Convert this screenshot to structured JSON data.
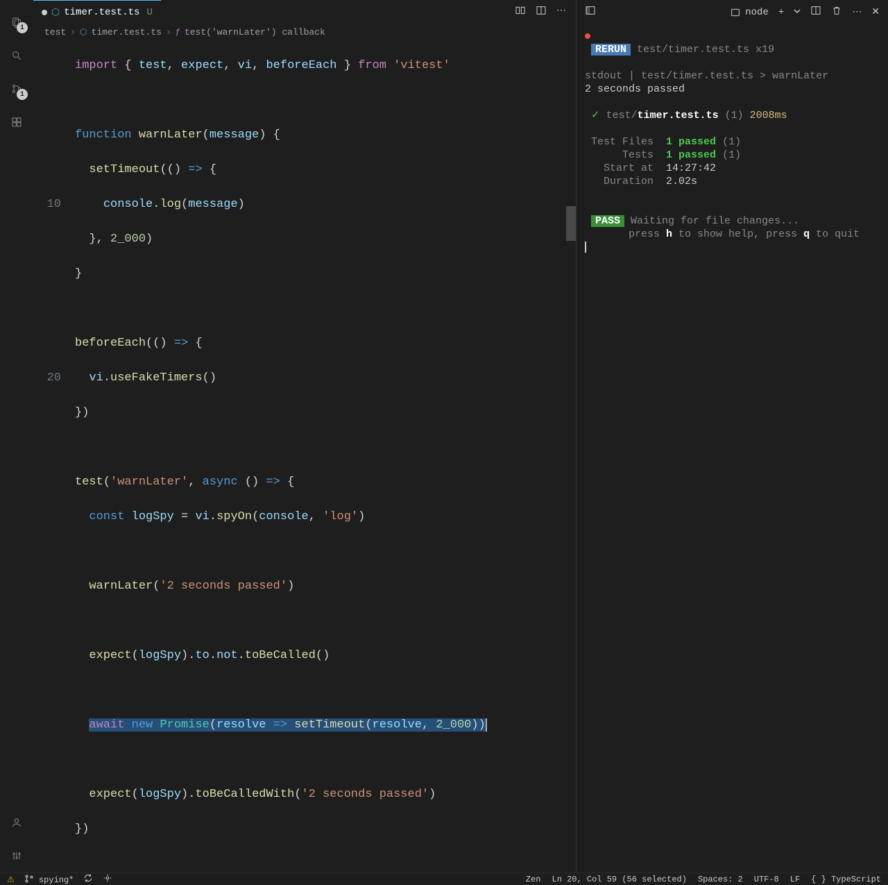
{
  "tab": {
    "filename": "timer.test.ts",
    "suffix": "U"
  },
  "breadcrumb": {
    "folder": "test",
    "file": "timer.test.ts",
    "symbol": "test('warnLater') callback"
  },
  "gutter": {
    "line10": "10",
    "line20": "20"
  },
  "code": {
    "l1": {
      "a": "import",
      "b": " { ",
      "c": "test",
      "d": ", ",
      "e": "expect",
      "f": ", ",
      "g": "vi",
      "h": ", ",
      "i": "beforeEach",
      "j": " } ",
      "k": "from",
      "l": " ",
      "m": "'vitest'"
    },
    "l3": {
      "a": "function",
      "b": " ",
      "c": "warnLater",
      "d": "(",
      "e": "message",
      "f": ") {"
    },
    "l4": {
      "a": "  ",
      "b": "setTimeout",
      "c": "(() ",
      "d": "=>",
      "e": " {"
    },
    "l5": {
      "a": "    ",
      "b": "console",
      "c": ".",
      "d": "log",
      "e": "(",
      "f": "message",
      "g": ")"
    },
    "l6": {
      "a": "  }, ",
      "b": "2_000",
      "c": ")"
    },
    "l7": {
      "a": "}"
    },
    "l9": {
      "a": "beforeEach",
      "b": "(() ",
      "c": "=>",
      "d": " {"
    },
    "l10": {
      "a": "  ",
      "b": "vi",
      "c": ".",
      "d": "useFakeTimers",
      "e": "()"
    },
    "l11": {
      "a": "})"
    },
    "l13": {
      "a": "test",
      "b": "(",
      "c": "'warnLater'",
      "d": ", ",
      "e": "async",
      "f": " () ",
      "g": "=>",
      "h": " {"
    },
    "l14": {
      "a": "  ",
      "b": "const",
      "c": " ",
      "d": "logSpy",
      "e": " = ",
      "f": "vi",
      "g": ".",
      "h": "spyOn",
      "i": "(",
      "j": "console",
      "k": ", ",
      "l": "'log'",
      "m": ")"
    },
    "l16": {
      "a": "  ",
      "b": "warnLater",
      "c": "(",
      "d": "'2 seconds passed'",
      "e": ")"
    },
    "l18": {
      "a": "  ",
      "b": "expect",
      "c": "(",
      "d": "logSpy",
      "e": ").",
      "f": "to",
      "g": ".",
      "h": "not",
      "i": ".",
      "j": "toBeCalled",
      "k": "()"
    },
    "l20": {
      "a": "  ",
      "b": "await",
      "c": " ",
      "d": "new",
      "e": " ",
      "f": "Promise",
      "g": "(",
      "h": "resolve",
      "i": " ",
      "j": "=>",
      "k": " ",
      "l": "setTimeout",
      "m": "(",
      "n": "resolve",
      "o": ", ",
      "p": "2_000",
      "q": "))"
    },
    "l22": {
      "a": "  ",
      "b": "expect",
      "c": "(",
      "d": "logSpy",
      "e": ").",
      "f": "toBeCalledWith",
      "g": "(",
      "h": "'2 seconds passed'",
      "i": ")"
    },
    "l23": {
      "a": "})"
    }
  },
  "terminal": {
    "header_label": "node",
    "rerun": "RERUN",
    "rerun_file": " test/timer.test.ts ",
    "rerun_count": "x19",
    "stdout_label": "stdout",
    "stdout_pipe": " | ",
    "stdout_path": "test/timer.test.ts > warnLater",
    "stdout_msg": "2 seconds passed",
    "check": "✓",
    "result_file": " test/",
    "result_file_bold": "timer.test.ts",
    "result_count": " (1) ",
    "result_time": "2008ms",
    "files_label": "Test Files  ",
    "files_pass": "1 passed",
    "files_total": " (1)",
    "tests_label": "     Tests  ",
    "tests_pass": "1 passed",
    "tests_total": " (1)",
    "start_label": "  Start at  ",
    "start_val": "14:27:42",
    "dur_label": "  Duration  ",
    "dur_val": "2.02s",
    "pass": "PASS",
    "waiting": " Waiting for file changes...",
    "help_pre": "       press ",
    "help_h": "h",
    "help_mid": " to show help, press ",
    "help_q": "q",
    "help_end": " to quit"
  },
  "statusbar": {
    "branch": "spying*",
    "zen": "Zen",
    "cursor": "Ln 20, Col 59 (56 selected)",
    "spaces": "Spaces: 2",
    "encoding": "UTF-8",
    "eol": "LF",
    "lang": "TypeScript"
  },
  "badges": {
    "explorer": "1",
    "scm": "1"
  }
}
